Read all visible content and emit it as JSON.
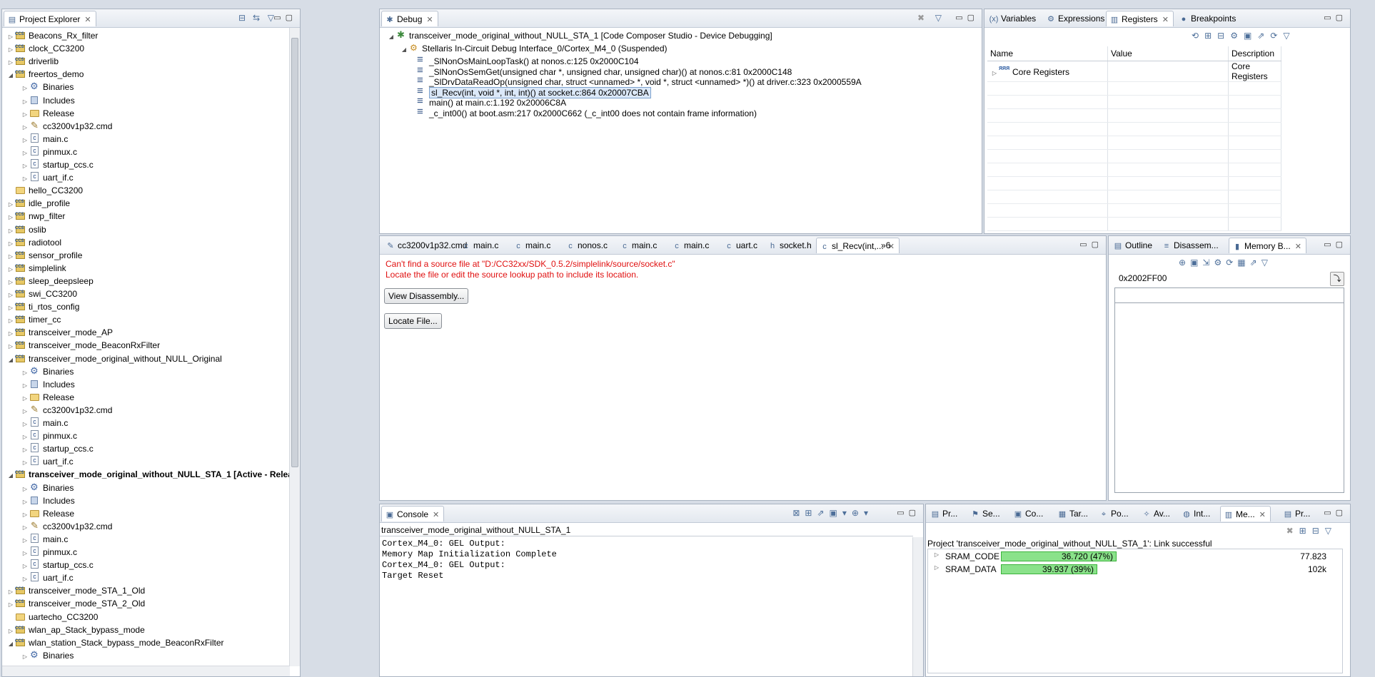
{
  "project_explorer": {
    "title": "Project Explorer",
    "items": [
      {
        "label": "Beacons_Rx_filter"
      },
      {
        "label": "clock_CC3200"
      },
      {
        "label": "driverlib"
      },
      {
        "label": "freertos_demo"
      },
      {
        "label": "Binaries"
      },
      {
        "label": "Includes"
      },
      {
        "label": "Release"
      },
      {
        "label": "cc3200v1p32.cmd"
      },
      {
        "label": "main.c"
      },
      {
        "label": "pinmux.c"
      },
      {
        "label": "startup_ccs.c"
      },
      {
        "label": "uart_if.c"
      },
      {
        "label": "hello_CC3200"
      },
      {
        "label": "idle_profile"
      },
      {
        "label": "nwp_filter"
      },
      {
        "label": "oslib"
      },
      {
        "label": "radiotool"
      },
      {
        "label": "sensor_profile"
      },
      {
        "label": "simplelink"
      },
      {
        "label": "sleep_deepsleep"
      },
      {
        "label": "swi_CC3200"
      },
      {
        "label": "ti_rtos_config"
      },
      {
        "label": "timer_cc"
      },
      {
        "label": "transceiver_mode_AP"
      },
      {
        "label": "transceiver_mode_BeaconRxFilter"
      },
      {
        "label": "transceiver_mode_original_without_NULL_Original"
      },
      {
        "label": "Binaries"
      },
      {
        "label": "Includes"
      },
      {
        "label": "Release"
      },
      {
        "label": "cc3200v1p32.cmd"
      },
      {
        "label": "main.c"
      },
      {
        "label": "pinmux.c"
      },
      {
        "label": "startup_ccs.c"
      },
      {
        "label": "uart_if.c"
      },
      {
        "label": "transceiver_mode_original_without_NULL_STA_1  [Active - Release]"
      },
      {
        "label": "Binaries"
      },
      {
        "label": "Includes"
      },
      {
        "label": "Release"
      },
      {
        "label": "cc3200v1p32.cmd"
      },
      {
        "label": "main.c"
      },
      {
        "label": "pinmux.c"
      },
      {
        "label": "startup_ccs.c"
      },
      {
        "label": "uart_if.c"
      },
      {
        "label": "transceiver_mode_STA_1_Old"
      },
      {
        "label": "transceiver_mode_STA_2_Old"
      },
      {
        "label": "uartecho_CC3200"
      },
      {
        "label": "wlan_ap_Stack_bypass_mode"
      },
      {
        "label": "wlan_station_Stack_bypass_mode_BeaconRxFilter"
      },
      {
        "label": "Binaries"
      }
    ]
  },
  "debug": {
    "title": "Debug",
    "session": "transceiver_mode_original_without_NULL_STA_1 [Code Composer Studio - Device Debugging]",
    "thread": "Stellaris In-Circuit Debug Interface_0/Cortex_M4_0 (Suspended)",
    "frames": [
      "_SlNonOsMainLoopTask() at nonos.c:125 0x2000C104",
      "_SlNonOsSemGet(unsigned char *, unsigned char, unsigned char)() at nonos.c:81 0x2000C148",
      "_SlDrvDataReadOp(unsigned char, struct <unnamed> *, void *, struct <unnamed> *)() at driver.c:323 0x2000559A",
      "sl_Recv(int, void *, int, int)() at socket.c:864 0x20007CBA",
      "main() at main.c:1.192 0x20006C8A",
      "_c_int00() at boot.asm:217 0x2000C662  (_c_int00 does not contain frame information)"
    ]
  },
  "registers_view": {
    "tabs": [
      "Variables",
      "Expressions",
      "Registers",
      "Breakpoints"
    ],
    "columns": [
      "Name",
      "Value",
      "Description"
    ],
    "rows": [
      {
        "name": "Core Registers",
        "value": "",
        "description": "Core Registers"
      }
    ]
  },
  "editor": {
    "tabs": [
      "cc3200v1p32.cmd",
      "main.c",
      "main.c",
      "nonos.c",
      "main.c",
      "main.c",
      "uart.c",
      "socket.h",
      "sl_Recv(int,...",
      "»6"
    ],
    "error_line1": "Can't find a source file at \"D:/CC32xx/SDK_0.5.2/simplelink/source/socket.c\"",
    "error_line2": "Locate the file or edit the source lookup path to include its location.",
    "view_disassembly": "View Disassembly...",
    "locate_file": "Locate File..."
  },
  "memory_view": {
    "tabs": [
      "Outline",
      "Disassem...",
      "Memory B..."
    ],
    "address": "0x2002FF00"
  },
  "console": {
    "title": "Console",
    "name": "transceiver_mode_original_without_NULL_STA_1",
    "lines": [
      "Cortex_M4_0: GEL Output:",
      "Memory Map Initialization Complete",
      "Cortex_M4_0: GEL Output:",
      "Target Reset"
    ]
  },
  "memory_allocation": {
    "tabs": [
      "Pr...",
      "Se...",
      "Co...",
      "Tar...",
      "Po...",
      "Av...",
      "Int...",
      "Me...",
      "Pr..."
    ],
    "status": "Project 'transceiver_mode_original_without_NULL_STA_1': Link successful",
    "rows": [
      {
        "name": "SRAM_CODE",
        "used": "36.720 (47%)",
        "total": "77.823",
        "fraction": 0.47
      },
      {
        "name": "SRAM_DATA",
        "used": "39.937 (39%)",
        "total": "102k",
        "fraction": 0.39
      }
    ]
  }
}
